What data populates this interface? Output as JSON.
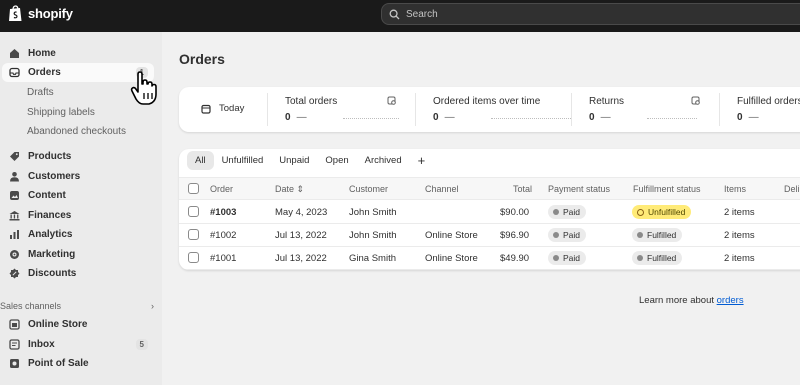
{
  "brand": {
    "name": "shopify"
  },
  "search": {
    "placeholder": "Search"
  },
  "sidebar": {
    "home": "Home",
    "orders": "Orders",
    "orders_count": "1",
    "sub": [
      "Drafts",
      "Shipping labels",
      "Abandoned checkouts"
    ],
    "products": "Products",
    "customers": "Customers",
    "content": "Content",
    "finances": "Finances",
    "analytics": "Analytics",
    "marketing": "Marketing",
    "discounts": "Discounts",
    "sales_channels": "Sales channels",
    "online_store": "Online Store",
    "inbox": "Inbox",
    "inbox_count": "5",
    "pos": "Point of Sale"
  },
  "page": {
    "title": "Orders"
  },
  "metrics": {
    "date": "Today",
    "items": [
      {
        "label": "Total orders",
        "value": "0"
      },
      {
        "label": "Ordered items over time",
        "value": "0"
      },
      {
        "label": "Returns",
        "value": "0"
      },
      {
        "label": "Fulfilled orders",
        "value": "0"
      }
    ],
    "dash": "—"
  },
  "tabs": [
    "All",
    "Unfulfilled",
    "Unpaid",
    "Open",
    "Archived"
  ],
  "table": {
    "headers": {
      "order": "Order",
      "date": "Date",
      "customer": "Customer",
      "channel": "Channel",
      "total": "Total",
      "payment": "Payment status",
      "fulfillment": "Fulfillment status",
      "items": "Items",
      "delivery": "Deli"
    },
    "rows": [
      {
        "order": "#1003",
        "date": "May 4, 2023",
        "customer": "John Smith",
        "channel": "",
        "total": "$90.00",
        "payment": "Paid",
        "fulfillment": "Unfulfilled",
        "items": "2 items"
      },
      {
        "order": "#1002",
        "date": "Jul 13, 2022",
        "customer": "John Smith",
        "channel": "Online Store",
        "total": "$96.90",
        "payment": "Paid",
        "fulfillment": "Fulfilled",
        "items": "2 items"
      },
      {
        "order": "#1001",
        "date": "Jul 13, 2022",
        "customer": "Gina Smith",
        "channel": "Online Store",
        "total": "$49.90",
        "payment": "Paid",
        "fulfillment": "Fulfilled",
        "items": "2 items"
      }
    ]
  },
  "footer": {
    "learn_prefix": "Learn more about",
    "learn_link": "orders"
  },
  "colors": {
    "topbar": "#1a1a1a",
    "link": "#005bd3",
    "warning_badge": "#ffeb78"
  },
  "icons": [
    "shopify-logo-icon",
    "search-icon",
    "home-icon",
    "orders-icon",
    "products-icon",
    "customers-icon",
    "content-icon",
    "finances-icon",
    "analytics-icon",
    "marketing-icon",
    "discounts-icon",
    "online-store-icon",
    "inbox-icon",
    "pos-icon",
    "calendar-icon",
    "metric-chart-icon",
    "plus-icon",
    "sort-icon",
    "hand-cursor-icon"
  ]
}
